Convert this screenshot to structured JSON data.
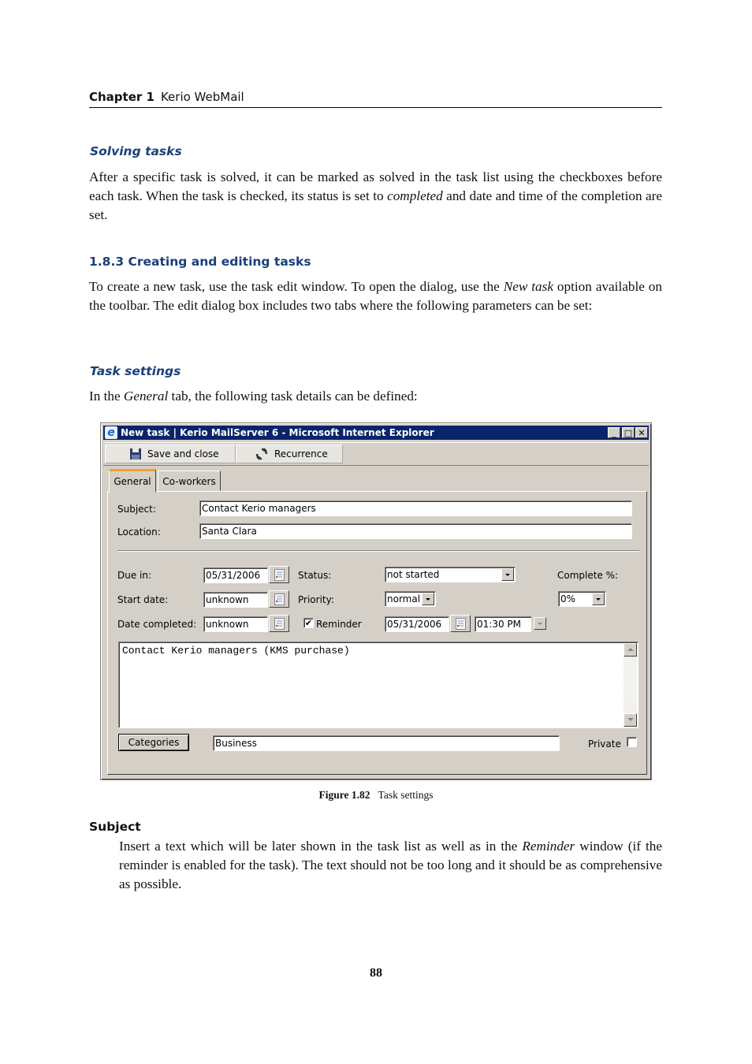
{
  "running_header": {
    "chapter": "Chapter 1",
    "title": "Kerio WebMail"
  },
  "solving": {
    "heading": "Solving tasks",
    "para_pre": "After a specific task is solved, it can be marked as solved in the task list using the checkboxes before each task. When the task is checked, its status is set to ",
    "para_em": "completed",
    "para_post": " and date and time of the completion are set."
  },
  "creating": {
    "heading": "1.8.3  Creating and editing tasks",
    "para_pre": "To create a new task, use the task edit window. To open the dialog, use the ",
    "para_em": "New task",
    "para_post": " option available on the toolbar. The edit dialog box includes two tabs where the following parameters can be set:"
  },
  "task_settings": {
    "heading": "Task settings",
    "para_pre": "In the ",
    "para_em": "General",
    "para_post": " tab, the following task details can be defined:"
  },
  "dialog": {
    "window_title": "New task | Kerio MailServer 6 - Microsoft Internet Explorer",
    "window_buttons": {
      "minimize": "_",
      "maximize": "□",
      "close": "✕"
    },
    "toolbar": {
      "save_close": "Save and close",
      "recurrence": "Recurrence"
    },
    "tabs": [
      {
        "label": "General",
        "active": true
      },
      {
        "label": "Co-workers",
        "active": false
      }
    ],
    "subject": {
      "label": "Subject:",
      "value": "Contact Kerio managers"
    },
    "location": {
      "label": "Location:",
      "value": "Santa Clara"
    },
    "due_in": {
      "label": "Due in:",
      "value": "05/31/2006"
    },
    "start_date": {
      "label": "Start date:",
      "value": "unknown"
    },
    "date_completed": {
      "label": "Date completed:",
      "value": "unknown"
    },
    "status": {
      "label": "Status:",
      "value": "not started"
    },
    "priority": {
      "label": "Priority:",
      "value": "normal"
    },
    "reminder": {
      "label": "Reminder",
      "checked": true,
      "check_glyph": "✔",
      "date": "05/31/2006",
      "time": "01:30 PM"
    },
    "complete": {
      "label": "Complete %:",
      "value": "0%"
    },
    "notes": "Contact Kerio managers (KMS purchase)",
    "categories": {
      "button": "Categories",
      "value": "Business"
    },
    "private": {
      "label": "Private",
      "checked": false
    }
  },
  "figure_caption": {
    "label": "Figure 1.82",
    "text": "Task settings"
  },
  "subject_section": {
    "term": "Subject",
    "para_pre": "Insert a text which will be later shown in the task list as well as in the ",
    "para_em": "Reminder",
    "para_post": " window (if the reminder is enabled for the task). The text should not be too long and it should be as comprehensive as possible."
  },
  "page_number": "88"
}
